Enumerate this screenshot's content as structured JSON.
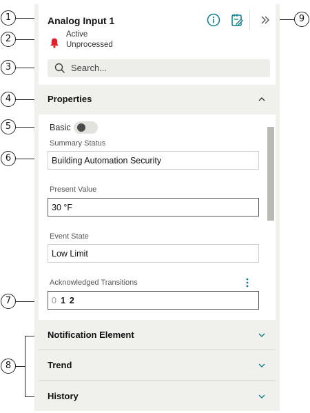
{
  "callouts": [
    "1",
    "2",
    "3",
    "4",
    "5",
    "6",
    "7",
    "8",
    "9"
  ],
  "header": {
    "title": "Analog Input 1",
    "icons": [
      "info-icon",
      "edit-notes-icon",
      "double-chevron-right-icon"
    ],
    "status_icon": "bell-icon",
    "status_line1": "Active",
    "status_line2": "Unprocessed"
  },
  "search": {
    "placeholder": "Search..."
  },
  "properties": {
    "title": "Properties",
    "basic_label": "Basic",
    "basic_enabled": false,
    "fields": [
      {
        "label": "Summary Status",
        "value": "Building Automation Security"
      },
      {
        "label": "Present Value",
        "value": "30 °F"
      },
      {
        "label": "Event State",
        "value": "Low Limit"
      }
    ],
    "acknowledged": {
      "label": "Acknowledged Transitions",
      "bits": [
        "0",
        "1",
        "2"
      ],
      "bits_active": [
        false,
        true,
        true
      ]
    }
  },
  "sections": [
    {
      "title": "Notification Element"
    },
    {
      "title": "Trend"
    },
    {
      "title": "History"
    }
  ],
  "colors": {
    "accent": "#0a7d8f",
    "alarm": "#e0202a",
    "panel_bg": "#f0f0ec"
  }
}
